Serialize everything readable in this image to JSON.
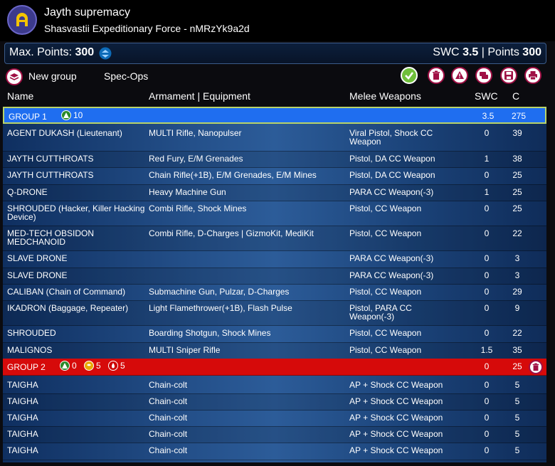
{
  "header": {
    "title": "Jayth supremacy",
    "subtitle": "Shasvastii Expeditionary Force - nMRzYk9a2d"
  },
  "points": {
    "max_label": "Max. Points:",
    "max_value": "300",
    "swc_label": "SWC",
    "swc_value": "3.5",
    "separator": "|",
    "points_label": "Points",
    "points_value": "300"
  },
  "toolbar": {
    "new_group_label": "New group",
    "spec_ops_label": "Spec-Ops",
    "buttons": [
      "check-icon",
      "trash-icon",
      "warning-icon",
      "chat-icon",
      "save-icon",
      "print-icon"
    ]
  },
  "columns": {
    "name": "Name",
    "armament": "Armament | Equipment",
    "melee": "Melee Weapons",
    "swc": "SWC",
    "cost": "C"
  },
  "group1": {
    "label": "GROUP 1",
    "regular_orders": "10",
    "swc": "3.5",
    "cost": "275",
    "units": [
      {
        "name": "AGENT DUKASH (Lieutenant)",
        "armament": "MULTI Rifle, Nanopulser",
        "melee": "Viral Pistol, Shock CC Weapon",
        "swc": "0",
        "cost": "39"
      },
      {
        "name": "JAYTH CUTTHROATS",
        "armament": "Red Fury, E/M Grenades",
        "melee": "Pistol, DA CC Weapon",
        "swc": "1",
        "cost": "38"
      },
      {
        "name": "JAYTH CUTTHROATS",
        "armament": "Chain Rifle(+1B), E/M Grenades, E/M Mines",
        "melee": "Pistol, DA CC Weapon",
        "swc": "0",
        "cost": "25"
      },
      {
        "name": "Q-DRONE",
        "armament": "Heavy Machine Gun",
        "melee": "PARA CC Weapon(-3)",
        "swc": "1",
        "cost": "25"
      },
      {
        "name": "SHROUDED (Hacker, Killer Hacking Device)",
        "armament": "Combi Rifle, Shock Mines",
        "melee": "Pistol, CC Weapon",
        "swc": "0",
        "cost": "25"
      },
      {
        "name": "MED-TECH OBSIDON MEDCHANOID",
        "armament": "Combi Rifle, D-Charges | GizmoKit, MediKit",
        "melee": "Pistol, CC Weapon",
        "swc": "0",
        "cost": "22"
      },
      {
        "name": "SLAVE DRONE",
        "armament": "",
        "melee": "PARA CC Weapon(-3)",
        "swc": "0",
        "cost": "3"
      },
      {
        "name": "SLAVE DRONE",
        "armament": "",
        "melee": "PARA CC Weapon(-3)",
        "swc": "0",
        "cost": "3"
      },
      {
        "name": "CALIBAN (Chain of Command)",
        "armament": "Submachine Gun, Pulzar, D-Charges",
        "melee": "Pistol, CC Weapon",
        "swc": "0",
        "cost": "29"
      },
      {
        "name": "IKADRON (Baggage, Repeater)",
        "armament": "Light Flamethrower(+1B), Flash Pulse",
        "melee": "Pistol, PARA CC Weapon(-3)",
        "swc": "0",
        "cost": "9"
      },
      {
        "name": "SHROUDED",
        "armament": "Boarding Shotgun, Shock Mines",
        "melee": "Pistol, CC Weapon",
        "swc": "0",
        "cost": "22"
      },
      {
        "name": "MALIGNOS",
        "armament": "MULTI Sniper Rifle",
        "melee": "Pistol, CC Weapon",
        "swc": "1.5",
        "cost": "35"
      }
    ]
  },
  "group2": {
    "label": "GROUP 2",
    "regular_orders": "0",
    "irregular_orders": "5",
    "impetuous_orders": "5",
    "swc": "0",
    "cost": "25",
    "units": [
      {
        "name": "TAIGHA",
        "armament": "Chain-colt",
        "melee": "AP + Shock CC Weapon",
        "swc": "0",
        "cost": "5"
      },
      {
        "name": "TAIGHA",
        "armament": "Chain-colt",
        "melee": "AP + Shock CC Weapon",
        "swc": "0",
        "cost": "5"
      },
      {
        "name": "TAIGHA",
        "armament": "Chain-colt",
        "melee": "AP + Shock CC Weapon",
        "swc": "0",
        "cost": "5"
      },
      {
        "name": "TAIGHA",
        "armament": "Chain-colt",
        "melee": "AP + Shock CC Weapon",
        "swc": "0",
        "cost": "5"
      },
      {
        "name": "TAIGHA",
        "armament": "Chain-colt",
        "melee": "AP + Shock CC Weapon",
        "swc": "0",
        "cost": "5"
      }
    ]
  },
  "colors": {
    "group1_bg": "#1f6ef0",
    "group2_bg": "#d60a0a",
    "accent_green": "#2a8a2a"
  }
}
